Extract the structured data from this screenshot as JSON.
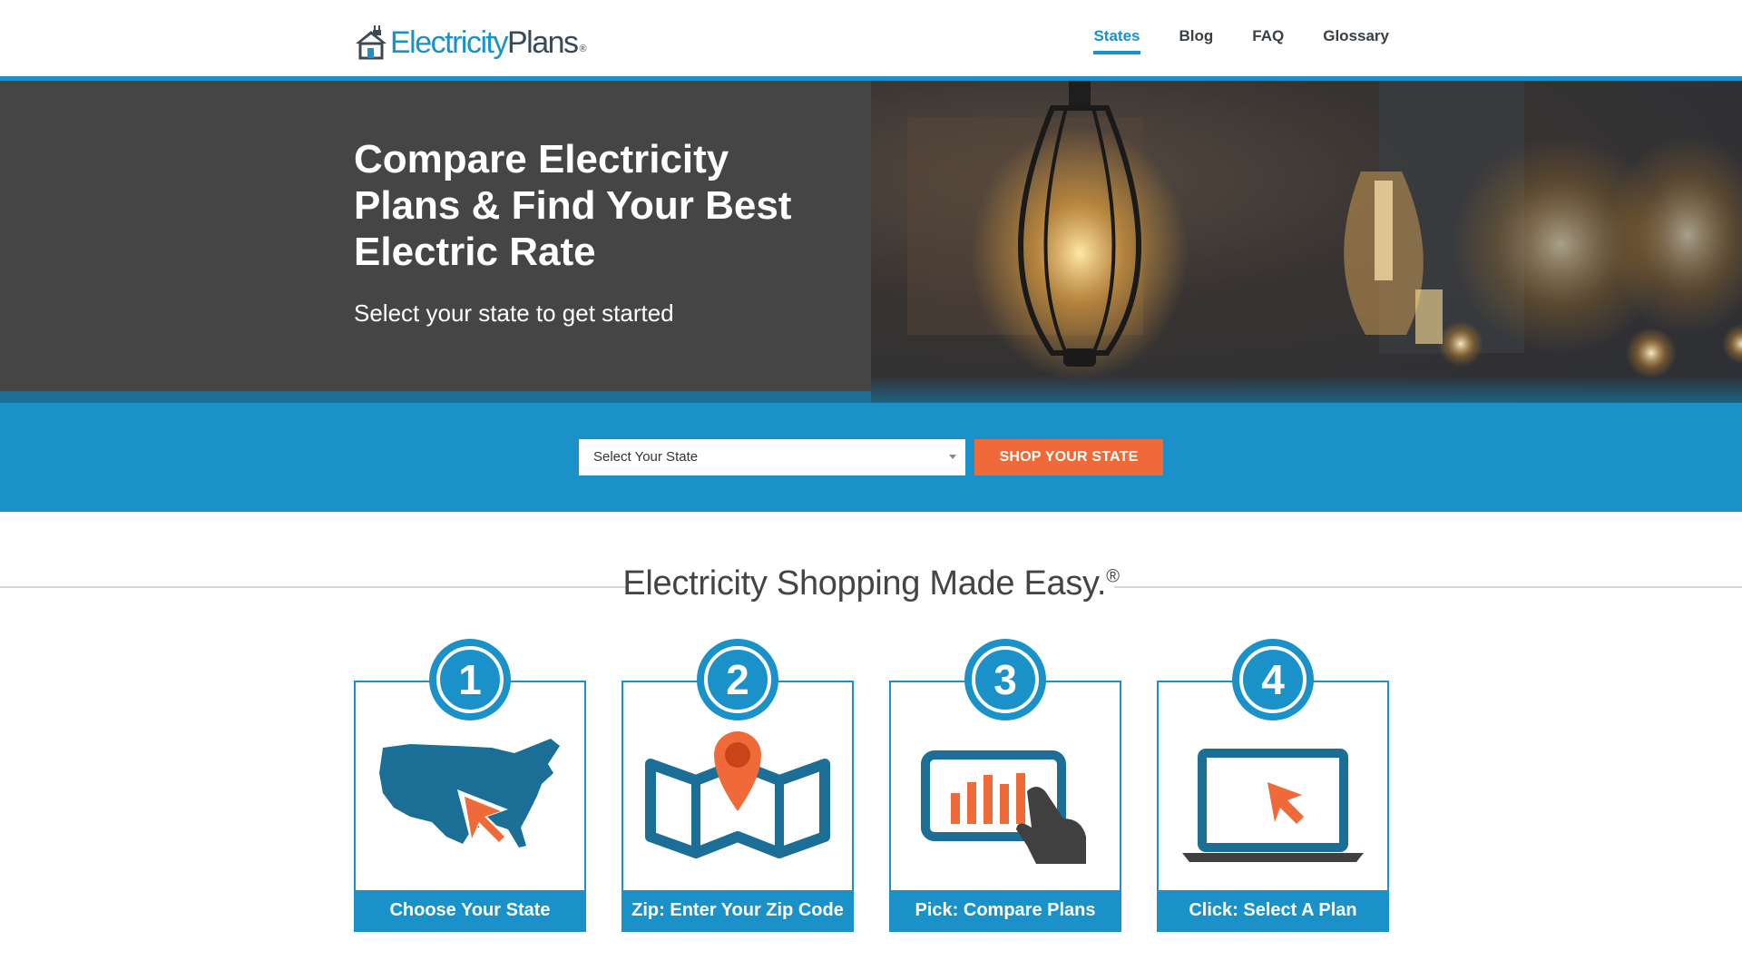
{
  "header": {
    "logo": {
      "part1": "Electricity",
      "part2": "Plans",
      "reg": "®"
    },
    "nav": [
      {
        "label": "States",
        "active": true
      },
      {
        "label": "Blog",
        "active": false
      },
      {
        "label": "FAQ",
        "active": false
      },
      {
        "label": "Glossary",
        "active": false
      }
    ]
  },
  "hero": {
    "title": "Compare Electricity Plans & Find Your Best Electric Rate",
    "subtitle": "Select your state to get started"
  },
  "search": {
    "select_value": "Select Your State",
    "button_label": "SHOP YOUR STATE"
  },
  "section": {
    "title": "Electricity Shopping Made Easy.",
    "title_mark": "®"
  },
  "steps": [
    {
      "number": "1",
      "label": "Choose Your State",
      "icon": "us-map-cursor-icon"
    },
    {
      "number": "2",
      "label": "Zip: Enter Your Zip Code",
      "icon": "map-pin-icon"
    },
    {
      "number": "3",
      "label": "Pick: Compare Plans",
      "icon": "tablet-chart-hand-icon"
    },
    {
      "number": "4",
      "label": "Click: Select A Plan",
      "icon": "laptop-cursor-icon"
    }
  ],
  "colors": {
    "accent_blue": "#1a91c9",
    "dark_blue": "#1b6f97",
    "orange": "#ef6a38",
    "hero_gray": "#454545",
    "icon_navy": "#1b6f97",
    "icon_gray": "#404040"
  }
}
